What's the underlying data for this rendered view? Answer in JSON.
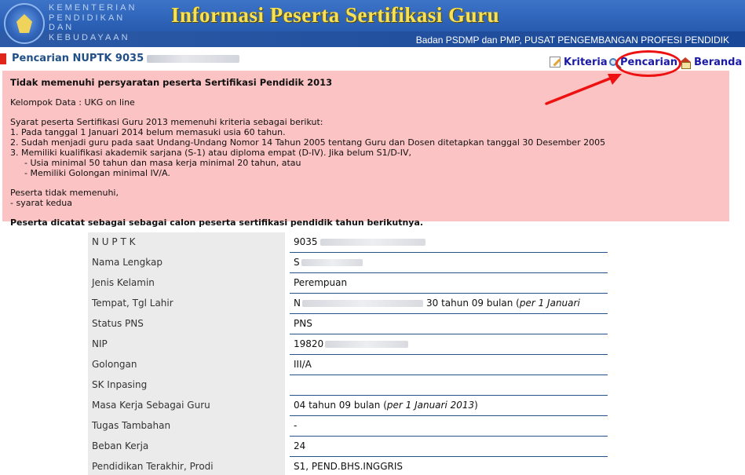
{
  "header": {
    "ministry_lines": [
      "KEMENTERIAN",
      "PENDIDIKAN",
      "DAN",
      "KEBUDAYAAN"
    ],
    "site_title": "Informasi Peserta Sertifikasi Guru",
    "subtitle": "Badan PSDMP dan PMP, PUSAT PENGEMBANGAN PROFESI PENDIDIK"
  },
  "page": {
    "title_prefix": "Pencarian NUPTK 9035"
  },
  "toplinks": {
    "kriteria": "Kriteria",
    "pencarian": "Pencarian",
    "beranda": "Beranda"
  },
  "alert": {
    "title": "Tidak memenuhi persyaratan peserta Sertifikasi Pendidik 2013",
    "kelompok": "Kelompok Data : UKG on line",
    "syarat_intro": "Syarat peserta Sertifikasi Guru 2013 memenuhi kriteria sebagai berikut:",
    "syarat_1": "1. Pada tanggal 1 Januari 2014 belum memasuki usia 60 tahun.",
    "syarat_2": "2. Sudah menjadi guru pada saat Undang-Undang Nomor 14 Tahun 2005 tentang Guru dan Dosen ditetapkan tanggal 30 Desember 2005",
    "syarat_3": "3. Memiliki kualifikasi akademik sarjana (S-1) atau diploma empat (D-IV). Jika belum S1/D-IV,",
    "syarat_3a": "- Usia minimal 50 tahun dan masa kerja minimal 20 tahun, atau",
    "syarat_3b": "- Memiliki Golongan minimal IV/A.",
    "tidak_memenuhi": "Peserta tidak memenuhi,",
    "alasan": "- syarat kedua",
    "kesimpulan": "Peserta dicatat sebagai sebagai calon peserta sertifikasi pendidik tahun berikutnya."
  },
  "details": [
    {
      "label": "N U P T K",
      "value": "9035"
    },
    {
      "label": "Nama Lengkap",
      "value": "S"
    },
    {
      "label": "Jenis Kelamin",
      "value": "Perempuan"
    },
    {
      "label": "Tempat, Tgl Lahir",
      "value": "N",
      "suffix": "30 tahun 09 bulan (",
      "suffix_italic": "per 1 Januari"
    },
    {
      "label": "Status PNS",
      "value": "PNS"
    },
    {
      "label": "NIP",
      "value": "19820"
    },
    {
      "label": "Golongan",
      "value": "III/A"
    },
    {
      "label": "SK Inpasing",
      "value": ""
    },
    {
      "label": "Masa Kerja Sebagai Guru",
      "value": "04 tahun 09 bulan (",
      "suffix_italic": "per 1 Januari 2013",
      "close": ")"
    },
    {
      "label": "Tugas Tambahan",
      "value": "-"
    },
    {
      "label": "Beban Kerja",
      "value": "24"
    },
    {
      "label": "Pendidikan Terakhir, Prodi",
      "value": "S1, PEND.BHS.INGGRIS"
    }
  ]
}
